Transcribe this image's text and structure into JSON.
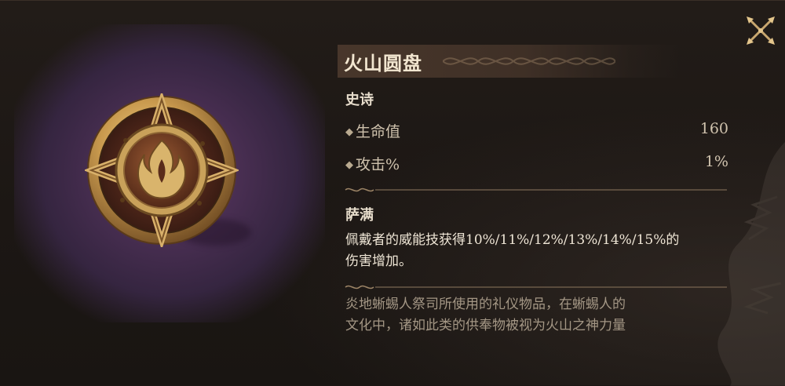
{
  "item": {
    "name": "火山圆盘",
    "rarity": "史诗",
    "icon": "volcano-flame-disc-icon"
  },
  "stats": [
    {
      "name": "生命值",
      "value": "160"
    },
    {
      "name": "攻击%",
      "value": "1%"
    }
  ],
  "set_section": {
    "title": "萨满",
    "effect_line1": "佩戴者的威能技获得10%/11%/12%/13%/14%/15%的",
    "effect_line2": "伤害增加。"
  },
  "lore": {
    "line1": "炎地蜥蜴人祭司所使用的礼仪物品，在蜥蜴人的",
    "line2": "文化中，诸如此类的供奉物被视为火山之神力量"
  },
  "controls": {
    "close_icon": "close-x-icon"
  },
  "colors": {
    "background": "#1b1613",
    "art_background": "#4a2f53",
    "title_text": "#f2e6d0",
    "stat_text": "#cfc2ad",
    "lore_text": "#a49785",
    "gold": "#c9a15a"
  }
}
